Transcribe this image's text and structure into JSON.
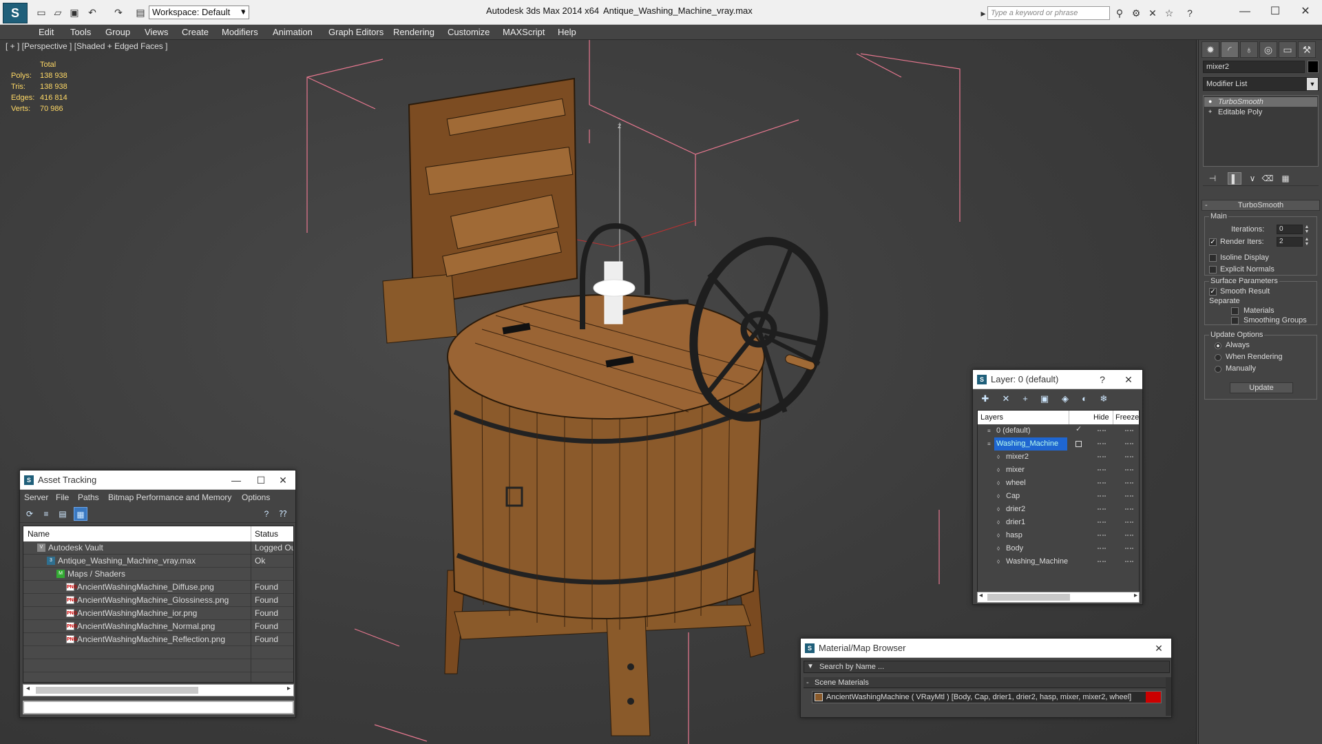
{
  "title_bar": {
    "app_name": "Autodesk 3ds Max  2014 x64",
    "file_name": "Antique_Washing_Machine_vray.max",
    "workspace": "Workspace: Default",
    "search_placeholder": "Type a keyword or phrase"
  },
  "menu": [
    "Edit",
    "Tools",
    "Group",
    "Views",
    "Create",
    "Modifiers",
    "Animation",
    "Graph Editors",
    "Rendering",
    "Customize",
    "MAXScript",
    "Help"
  ],
  "viewport": {
    "label": "[ + ] [Perspective ] [Shaded + Edged Faces ]",
    "stats": {
      "header": "Total",
      "rows": [
        {
          "label": "Polys:",
          "value": "138 938"
        },
        {
          "label": "Tris:",
          "value": "138 938"
        },
        {
          "label": "Edges:",
          "value": "416 814"
        },
        {
          "label": "Verts:",
          "value": "70 986"
        }
      ]
    },
    "axis_z": "z"
  },
  "command_panel": {
    "object_name": "mixer2",
    "modifier_list": "Modifier List",
    "stack": [
      "TurboSmooth",
      "Editable Poly"
    ],
    "rollout_title": "TurboSmooth",
    "main": {
      "title": "Main",
      "iterations_label": "Iterations:",
      "iterations_value": "0",
      "render_iters_label": "Render Iters:",
      "render_iters_value": "2",
      "render_iters_checked": true,
      "isoline_label": "Isoline Display",
      "explicit_normals_label": "Explicit Normals"
    },
    "surface": {
      "title": "Surface Parameters",
      "smooth_result_label": "Smooth Result",
      "separate_label": "Separate",
      "materials_label": "Materials",
      "smoothing_groups_label": "Smoothing Groups"
    },
    "update_options": {
      "title": "Update Options",
      "always": "Always",
      "when_rendering": "When Rendering",
      "manually": "Manually",
      "update_button": "Update"
    }
  },
  "asset_tracking": {
    "title": "Asset Tracking",
    "menu": [
      "Server",
      "File",
      "Paths",
      "Bitmap Performance and Memory",
      "Options"
    ],
    "col_name": "Name",
    "col_status": "Status",
    "rows": [
      {
        "name": "Autodesk Vault",
        "status": "Logged Ou",
        "indent": 1,
        "icon": "vault"
      },
      {
        "name": "Antique_Washing_Machine_vray.max",
        "status": "Ok",
        "indent": 2,
        "icon": "max"
      },
      {
        "name": "Maps / Shaders",
        "status": "",
        "indent": 3,
        "icon": "maps"
      },
      {
        "name": "AncientWashingMachine_Diffuse.png",
        "status": "Found",
        "indent": 4,
        "icon": "png"
      },
      {
        "name": "AncientWashingMachine_Glossiness.png",
        "status": "Found",
        "indent": 4,
        "icon": "png"
      },
      {
        "name": "AncientWashingMachine_ior.png",
        "status": "Found",
        "indent": 4,
        "icon": "png"
      },
      {
        "name": "AncientWashingMachine_Normal.png",
        "status": "Found",
        "indent": 4,
        "icon": "png"
      },
      {
        "name": "AncientWashingMachine_Reflection.png",
        "status": "Found",
        "indent": 4,
        "icon": "png"
      }
    ]
  },
  "layer_window": {
    "title": "Layer: 0 (default)",
    "help": "?",
    "col_layers": "Layers",
    "col_hide": "Hide",
    "col_freeze": "Freeze",
    "rows": [
      {
        "name": "0 (default)",
        "level": 0,
        "selected": false,
        "active": true
      },
      {
        "name": "Washing_Machine",
        "level": 0,
        "selected": true,
        "active": false
      },
      {
        "name": "mixer2",
        "level": 1,
        "selected": false,
        "active": false
      },
      {
        "name": "mixer",
        "level": 1,
        "selected": false,
        "active": false
      },
      {
        "name": "wheel",
        "level": 1,
        "selected": false,
        "active": false
      },
      {
        "name": "Cap",
        "level": 1,
        "selected": false,
        "active": false
      },
      {
        "name": "drier2",
        "level": 1,
        "selected": false,
        "active": false
      },
      {
        "name": "drier1",
        "level": 1,
        "selected": false,
        "active": false
      },
      {
        "name": "hasp",
        "level": 1,
        "selected": false,
        "active": false
      },
      {
        "name": "Body",
        "level": 1,
        "selected": false,
        "active": false
      },
      {
        "name": "Washing_Machine",
        "level": 1,
        "selected": false,
        "active": false
      }
    ]
  },
  "material_browser": {
    "title": "Material/Map Browser",
    "search_placeholder": "Search by Name ...",
    "section": "Scene Materials",
    "item": "AncientWashingMachine  ( VRayMtl ) [Body, Cap, drier1, drier2, hasp, mixer, mixer2, wheel]",
    "swatch_color": "#cc0000"
  },
  "colors": {
    "selection_blue": "#1f66d1",
    "stats_yellow": "#ffd966",
    "bounding_box_pink": "#e87890",
    "wood": "#8a5a2a"
  }
}
